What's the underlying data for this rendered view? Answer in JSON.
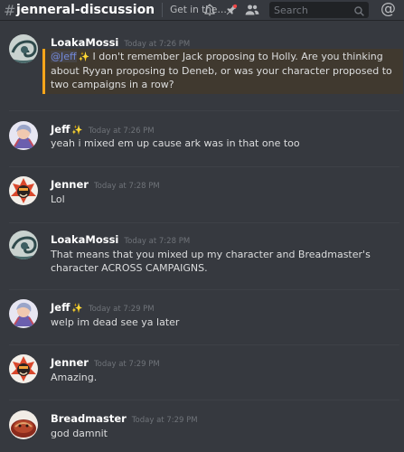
{
  "header": {
    "channel_name": "jenneral-discussion",
    "topic": "Get in the b...",
    "search_placeholder": "Search",
    "icons": [
      "bell-icon",
      "pin-icon",
      "members-icon",
      "search-icon",
      "mentions-icon"
    ]
  },
  "messages": [
    {
      "author": "LoakaMossi",
      "sparkle": "",
      "timestamp": "Today at 7:26 PM",
      "mention": "@Jeff",
      "mention_sparkle": "✨",
      "text": " I don't remember Jack proposing to Holly. Are you thinking about Ryyan proposing to Deneb, or was your character proposed to two campaigns in a row?"
    },
    {
      "author": "Jeff",
      "sparkle": "✨",
      "timestamp": "Today at 7:26 PM",
      "text": "yeah i mixed em up cause ark was in that one too"
    },
    {
      "author": "Jenner",
      "sparkle": "",
      "timestamp": "Today at 7:28 PM",
      "text": "Lol"
    },
    {
      "author": "LoakaMossi",
      "sparkle": "",
      "timestamp": "Today at 7:28 PM",
      "text": "That means that you mixed up my character and Breadmaster's character ACROSS CAMPAIGNS."
    },
    {
      "author": "Jeff",
      "sparkle": "✨",
      "timestamp": "Today at 7:29 PM",
      "text": "welp im dead see ya later"
    },
    {
      "author": "Jenner",
      "sparkle": "",
      "timestamp": "Today at 7:29 PM",
      "text": "Amazing."
    },
    {
      "author": "Breadmaster",
      "sparkle": "",
      "timestamp": "Today at 7:29 PM",
      "text": "god damnit"
    }
  ]
}
